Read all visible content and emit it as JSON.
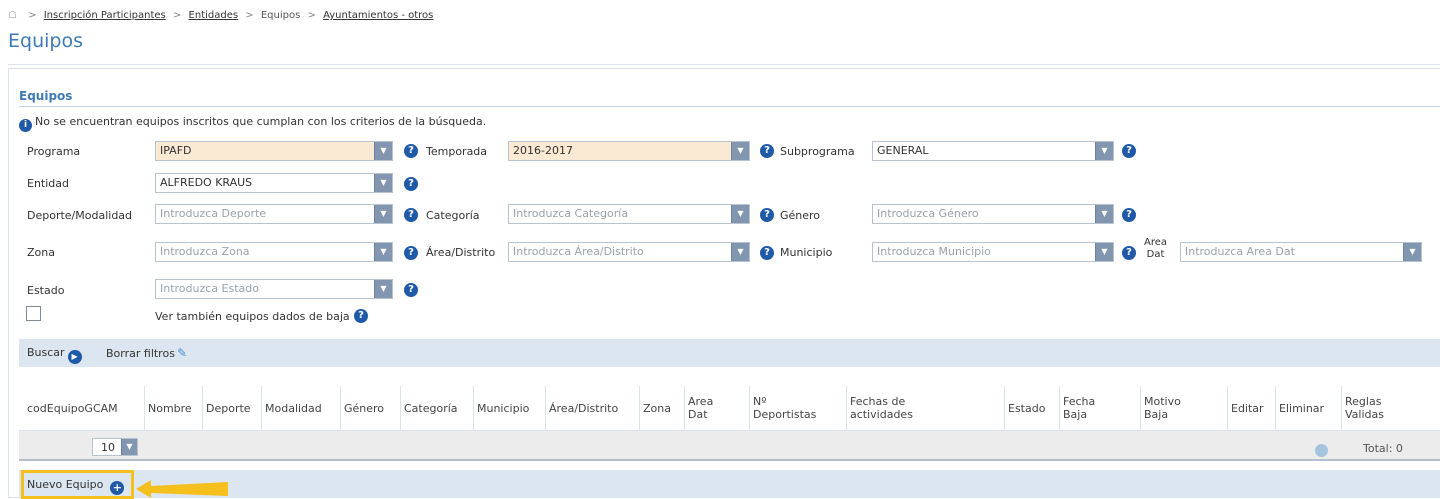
{
  "breadcrumb": {
    "home_icon": "home-icon",
    "sep": ">",
    "items": [
      "Inscripción Participantes",
      "Entidades",
      "Equipos",
      "Ayuntamientos - otros"
    ]
  },
  "page_title": "Equipos",
  "section": {
    "title": "Equipos",
    "info_message": "No se encuentran equipos inscritos que cumplan con los criterios de la búsqueda."
  },
  "filters": {
    "programa": {
      "label": "Programa",
      "value": "IPAFD"
    },
    "temporada": {
      "label": "Temporada",
      "value": "2016-2017"
    },
    "subprograma": {
      "label": "Subprograma",
      "value": "GENERAL"
    },
    "entidad": {
      "label": "Entidad",
      "value": "ALFREDO KRAUS"
    },
    "deporte": {
      "label": "Deporte/Modalidad",
      "placeholder": "Introduzca Deporte"
    },
    "categoria": {
      "label": "Categoría",
      "placeholder": "Introduzca Categoría"
    },
    "genero": {
      "label": "Género",
      "placeholder": "Introduzca Género"
    },
    "zona": {
      "label": "Zona",
      "placeholder": "Introduzca Zona"
    },
    "area_distrito": {
      "label": "Área/Distrito",
      "placeholder": "Introduzca Área/Distrito"
    },
    "municipio": {
      "label": "Municipio",
      "placeholder": "Introduzca Municipio"
    },
    "area_dat": {
      "label_line1": "Area",
      "label_line2": "Dat",
      "placeholder": "Introduzca Area Dat"
    },
    "estado": {
      "label": "Estado",
      "placeholder": "Introduzca Estado"
    },
    "ver_baja": {
      "label": "Ver también equipos dados de baja",
      "checked": false
    }
  },
  "toolbar": {
    "search_label": "Buscar",
    "clear_label": "Borrar filtros"
  },
  "table": {
    "columns": [
      {
        "l1": "codEquipoGCAM",
        "l2": ""
      },
      {
        "l1": "Nombre",
        "l2": ""
      },
      {
        "l1": "Deporte",
        "l2": ""
      },
      {
        "l1": "Modalidad",
        "l2": ""
      },
      {
        "l1": "Género",
        "l2": ""
      },
      {
        "l1": "Categoría",
        "l2": ""
      },
      {
        "l1": "Municipio",
        "l2": ""
      },
      {
        "l1": "Área/Distrito",
        "l2": ""
      },
      {
        "l1": "Zona",
        "l2": ""
      },
      {
        "l1": "Area",
        "l2": "Dat"
      },
      {
        "l1": "Nº",
        "l2": "Deportistas"
      },
      {
        "l1": "Fechas de",
        "l2": "actividades"
      },
      {
        "l1": "Estado",
        "l2": ""
      },
      {
        "l1": "Fecha",
        "l2": "Baja"
      },
      {
        "l1": "Motivo",
        "l2": "Baja"
      },
      {
        "l1": "Editar",
        "l2": ""
      },
      {
        "l1": "Eliminar",
        "l2": ""
      },
      {
        "l1": "Reglas",
        "l2": "Validas"
      }
    ],
    "page_size": "10",
    "total_label": "Total: 0"
  },
  "new_button_label": "Nuevo Equipo",
  "colors": {
    "accent": "#3f7ab5",
    "help": "#1e5aa8",
    "highlight": "#f5bf1c",
    "required_bg": "#fbead3"
  }
}
